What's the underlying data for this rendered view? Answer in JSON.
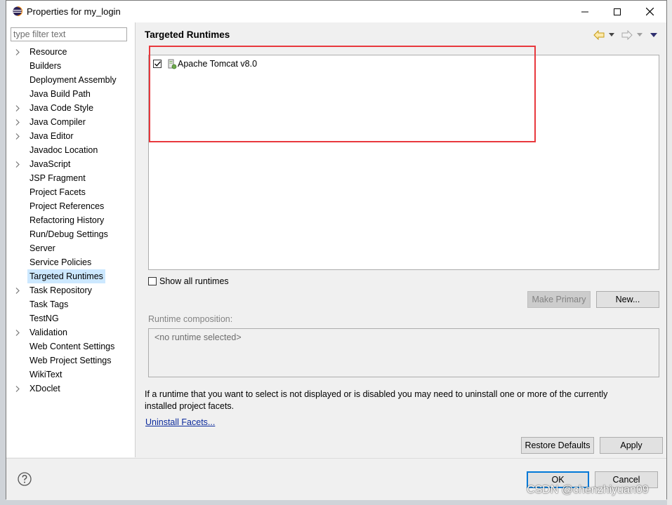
{
  "window": {
    "title": "Properties for my_login"
  },
  "filter": {
    "placeholder": "type filter text"
  },
  "tree": {
    "items": [
      {
        "label": "Resource",
        "expandable": true
      },
      {
        "label": "Builders",
        "expandable": false
      },
      {
        "label": "Deployment Assembly",
        "expandable": false
      },
      {
        "label": "Java Build Path",
        "expandable": false
      },
      {
        "label": "Java Code Style",
        "expandable": true
      },
      {
        "label": "Java Compiler",
        "expandable": true
      },
      {
        "label": "Java Editor",
        "expandable": true
      },
      {
        "label": "Javadoc Location",
        "expandable": false
      },
      {
        "label": "JavaScript",
        "expandable": true
      },
      {
        "label": "JSP Fragment",
        "expandable": false
      },
      {
        "label": "Project Facets",
        "expandable": false
      },
      {
        "label": "Project References",
        "expandable": false
      },
      {
        "label": "Refactoring History",
        "expandable": false
      },
      {
        "label": "Run/Debug Settings",
        "expandable": false
      },
      {
        "label": "Server",
        "expandable": false
      },
      {
        "label": "Service Policies",
        "expandable": false
      },
      {
        "label": "Targeted Runtimes",
        "expandable": false,
        "selected": true
      },
      {
        "label": "Task Repository",
        "expandable": true
      },
      {
        "label": "Task Tags",
        "expandable": false
      },
      {
        "label": "TestNG",
        "expandable": false
      },
      {
        "label": "Validation",
        "expandable": true
      },
      {
        "label": "Web Content Settings",
        "expandable": false
      },
      {
        "label": "Web Project Settings",
        "expandable": false
      },
      {
        "label": "WikiText",
        "expandable": false
      },
      {
        "label": "XDoclet",
        "expandable": true
      }
    ]
  },
  "page": {
    "title": "Targeted Runtimes",
    "runtimes": [
      {
        "name": "Apache Tomcat v8.0",
        "checked": true
      }
    ],
    "show_all_label": "Show all runtimes",
    "make_primary_label": "Make Primary",
    "new_label": "New...",
    "composition_label": "Runtime composition:",
    "composition_text": "<no runtime selected>",
    "info_line1": "If a runtime that you want to select is not displayed or is disabled you may need to uninstall one or more of the currently",
    "info_line2": "installed project facets.",
    "uninstall_link": "Uninstall Facets...",
    "restore_defaults_label": "Restore Defaults",
    "apply_label": "Apply"
  },
  "footer": {
    "ok_label": "OK",
    "cancel_label": "Cancel"
  },
  "watermark": "CSDN @chenzhiyuan09",
  "colors": {
    "selection": "#cce8ff",
    "highlight_box": "#e8383d",
    "link": "#0b2a9c",
    "default_button_border": "#0078d7"
  }
}
